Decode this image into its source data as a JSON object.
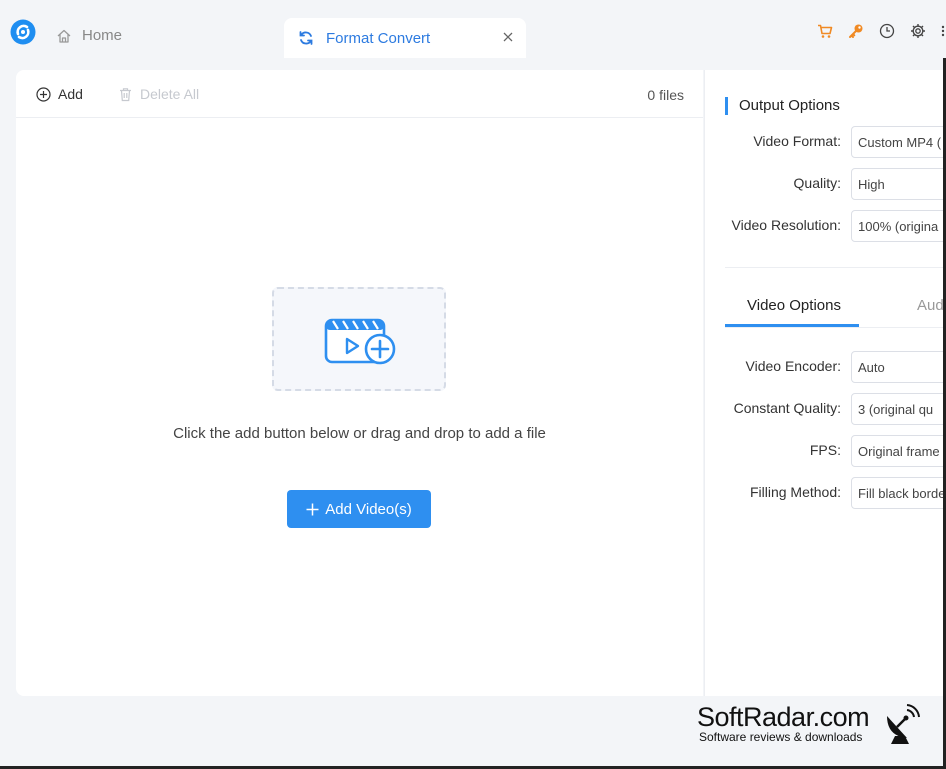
{
  "titlebar": {
    "home_tab": "Home",
    "active_tab": "Format Convert",
    "icons": [
      "cart-icon",
      "key-icon",
      "history-icon",
      "gear-icon",
      "more-icon"
    ],
    "accent_color": "#2e8ff0",
    "shop_color": "#f08a24"
  },
  "toolbar": {
    "add_label": "Add",
    "delete_all_label": "Delete All",
    "file_count": "0 files"
  },
  "dropzone": {
    "hint": "Click the add button below or drag and drop to add a file",
    "add_button": "Add Video(s)"
  },
  "output_options": {
    "title": "Output Options",
    "video_format": {
      "label": "Video Format:",
      "value": "Custom MP4 ("
    },
    "quality": {
      "label": "Quality:",
      "value": "High"
    },
    "resolution": {
      "label": "Video Resolution:",
      "value": "100% (origina"
    }
  },
  "subtabs": {
    "video": "Video Options",
    "audio": "Audi"
  },
  "video_options": {
    "encoder": {
      "label": "Video Encoder:",
      "value": "Auto"
    },
    "constant_quality": {
      "label": "Constant Quality:",
      "value": "3 (original qu"
    },
    "fps": {
      "label": "FPS:",
      "value": "Original frame"
    },
    "filling": {
      "label": "Filling Method:",
      "value": "Fill black borde"
    }
  },
  "watermark": {
    "title": "SoftRadar.com",
    "subtitle": "Software reviews & downloads"
  }
}
